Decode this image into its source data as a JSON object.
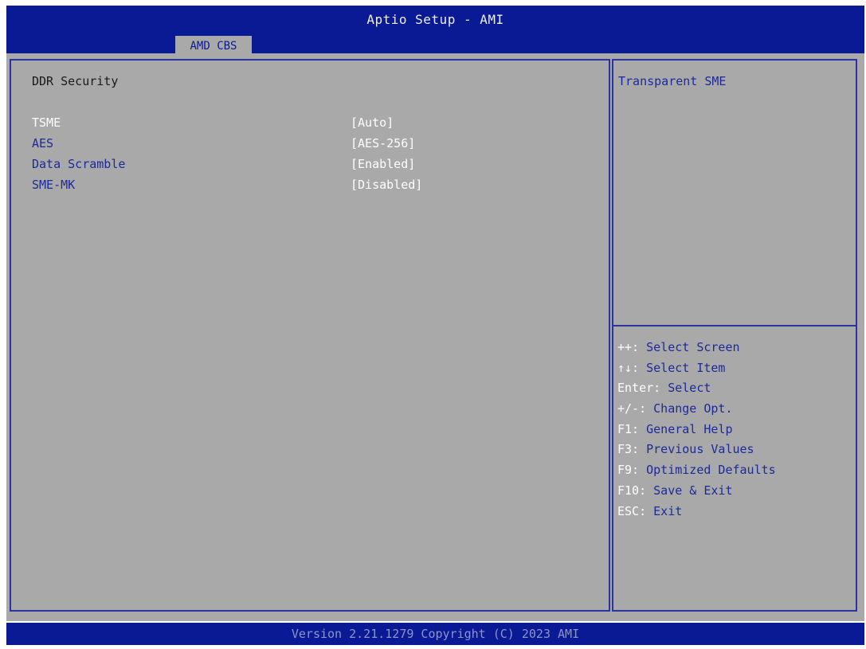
{
  "window": {
    "title": "Aptio Setup - AMI"
  },
  "tabs": [
    {
      "label": "AMD CBS",
      "active": true
    }
  ],
  "main": {
    "section_title": "DDR Security",
    "options": [
      {
        "label": "TSME",
        "value": "[Auto]",
        "selected": true
      },
      {
        "label": "AES",
        "value": "[AES-256]",
        "selected": false
      },
      {
        "label": "Data Scramble",
        "value": "[Enabled]",
        "selected": false
      },
      {
        "label": "SME-MK",
        "value": "[Disabled]",
        "selected": false
      }
    ]
  },
  "help": {
    "description": "Transparent SME",
    "keys": [
      {
        "key": "++:",
        "action": " Select Screen"
      },
      {
        "key": "↑↓:",
        "action": " Select Item"
      },
      {
        "key": "Enter:",
        "action": " Select"
      },
      {
        "key": "+/-:",
        "action": " Change Opt."
      },
      {
        "key": "F1:",
        "action": " General Help"
      },
      {
        "key": "F3:",
        "action": " Previous Values"
      },
      {
        "key": "F9:",
        "action": " Optimized Defaults"
      },
      {
        "key": "F10:",
        "action": " Save & Exit"
      },
      {
        "key": "ESC:",
        "action": " Exit"
      }
    ]
  },
  "footer": {
    "version": "Version 2.21.1279 Copyright (C) 2023 AMI"
  },
  "colors": {
    "bar_blue": "#0a1a95",
    "panel_gray": "#a9a9a9",
    "label_blue": "#1c2a9a",
    "value_white": "#ffffff"
  }
}
